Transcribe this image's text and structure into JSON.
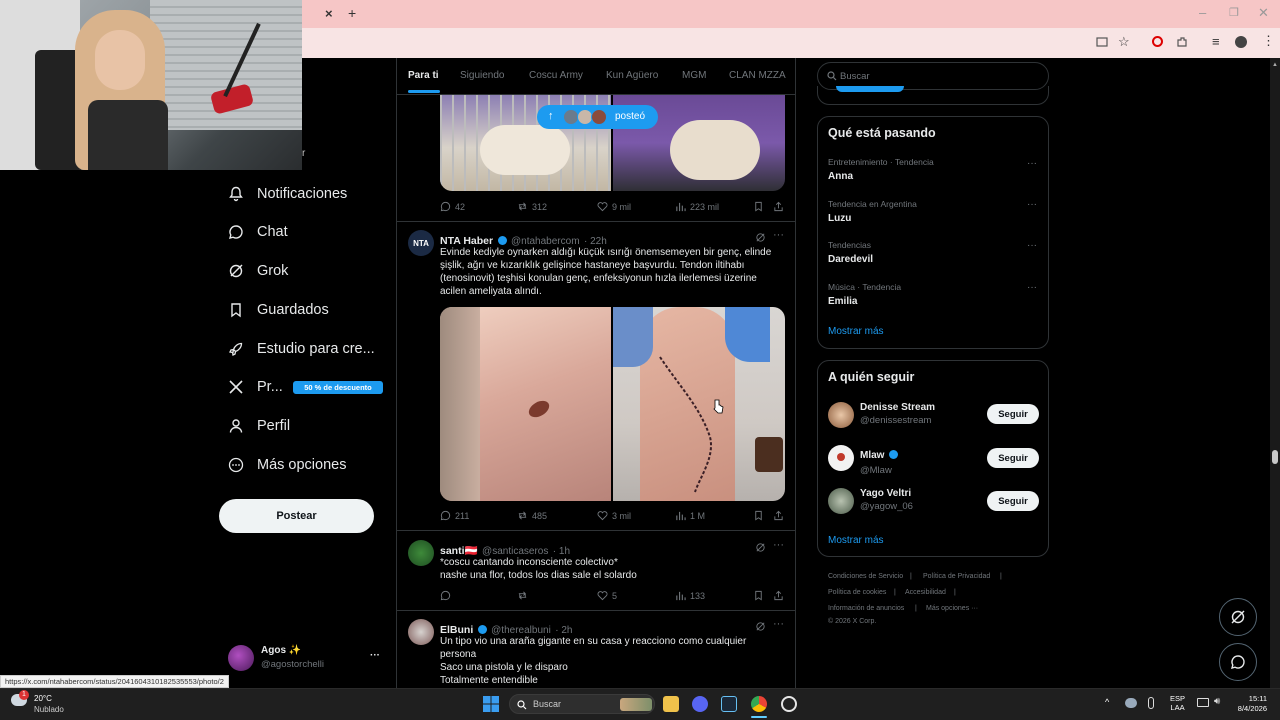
{
  "browser": {
    "tab_close": "×",
    "new_tab": "+",
    "status_url": "https://x.com/ntahabercom/status/2041604310182535553/photo/2"
  },
  "sidebar": {
    "items": [
      {
        "label": "Notificaciones",
        "icon": "bell-icon"
      },
      {
        "label": "Chat",
        "icon": "chat-icon"
      },
      {
        "label": "Grok",
        "icon": "grok-icon"
      },
      {
        "label": "Guardados",
        "icon": "bookmark-icon"
      },
      {
        "label": "Estudio para cre...",
        "icon": "rocket-icon"
      },
      {
        "label": "Pr...",
        "icon": "x-logo-icon",
        "badge": "50 % de descuento"
      },
      {
        "label": "Perfil",
        "icon": "person-icon"
      },
      {
        "label": "Más opciones",
        "icon": "more-circle-icon"
      }
    ],
    "post_button": "Postear",
    "account": {
      "name": "Agos ✨",
      "handle": "@agostorchelli",
      "more": "···"
    }
  },
  "feed": {
    "tabs": [
      "Para ti",
      "Siguiendo",
      "Coscu Army",
      "Kun Agüero",
      "MGM",
      "CLAN MZZA"
    ],
    "posted_pill": "posteó",
    "tweets": [
      {
        "replies": "42",
        "retweets": "312",
        "likes": "9 mil",
        "views": "223 mil"
      },
      {
        "name": "NTA Haber",
        "handle": "@ntahabercom",
        "time": "· 22h",
        "avatar": "NTA",
        "text": "Evinde kediyle oynarken aldığı küçük ısırığı önemsemeyen bir genç, elinde şişlik, ağrı ve kızarıklık gelişince hastaneye başvurdu. Tendon iltihabı (tenosinovit) teşhisi konulan genç, enfeksiyonun hızla ilerlemesi üzerine acilen ameliyata alındı.",
        "replies": "211",
        "retweets": "485",
        "likes": "3 mil",
        "views": "1 M"
      },
      {
        "name": "santi🇦🇹",
        "handle": "@santicaseros",
        "time": "· 1h",
        "text1": "*coscu cantando inconsciente colectivo*",
        "text2": "nashe una flor, todos los dias sale el solardo",
        "replies": "",
        "retweets": "",
        "likes": "5",
        "views": "133"
      },
      {
        "name": "ElBuni",
        "handle": "@therealbuni",
        "time": "· 2h",
        "lines": [
          "Un tipo vio una araña gigante en su casa y reacciono como cualquier",
          "persona",
          "Saco una pistola y le disparo",
          "Totalmente entendible"
        ]
      }
    ]
  },
  "right": {
    "search_placeholder": "Buscar",
    "trends_title": "Qué está pasando",
    "trends": [
      {
        "meta": "Entretenimiento · Tendencia",
        "name": "Anna"
      },
      {
        "meta": "Tendencia en Argentina",
        "name": "Luzu"
      },
      {
        "meta": "Tendencias",
        "name": "Daredevil"
      },
      {
        "meta": "Música · Tendencia",
        "name": "Emilia"
      }
    ],
    "show_more": "Mostrar más",
    "follow_title": "A quién seguir",
    "follow": [
      {
        "name": "Denisse Stream",
        "handle": "@denissestream",
        "button": "Seguir"
      },
      {
        "name": "Mlaw",
        "handle": "@Mlaw",
        "button": "Seguir"
      },
      {
        "name": "Yago Veltri",
        "handle": "@yagow_06",
        "button": "Seguir"
      }
    ],
    "show_more2": "Mostrar más",
    "footer": [
      "Condiciones de Servicio",
      "Política de Privacidad",
      "Política de cookies",
      "Accesibilidad",
      "Información de anuncios",
      "Más opciones ···",
      "© 2026 X Corp."
    ]
  },
  "taskbar": {
    "weather_temp": "20°C",
    "weather_desc": "Nublado",
    "search": "Buscar",
    "lang1": "ESP",
    "lang2": "LAA",
    "time": "15:11",
    "date": "8/4/2026"
  },
  "colors": {
    "accent": "#1d9bf0",
    "tab_bar": "#f6c6c6",
    "badge": "#1d9bf0"
  }
}
